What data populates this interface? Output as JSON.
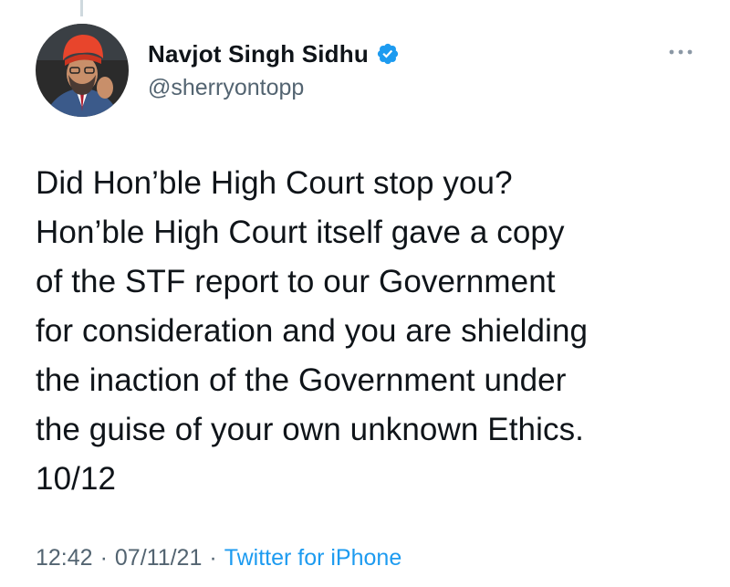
{
  "author": {
    "display_name": "Navjot Singh Sidhu",
    "handle": "@sherryontopp",
    "verified": true
  },
  "icons": {
    "verified": "verified-badge-icon",
    "more": "more-options-icon"
  },
  "tweet": {
    "text": "Did Hon’ble High Court stop you?\nHon’ble High Court itself gave a copy\nof the STF report to our Government\nfor consideration and you are shielding\nthe inaction of the Government under\nthe guise of your own unknown Ethics.\n10/12"
  },
  "meta": {
    "time": "12:42",
    "date": "07/11/21",
    "separator": "·",
    "source": "Twitter for iPhone"
  },
  "colors": {
    "text": "#0f1419",
    "secondary": "#536471",
    "accent": "#1d9bf0",
    "turban": "#e8452c"
  }
}
